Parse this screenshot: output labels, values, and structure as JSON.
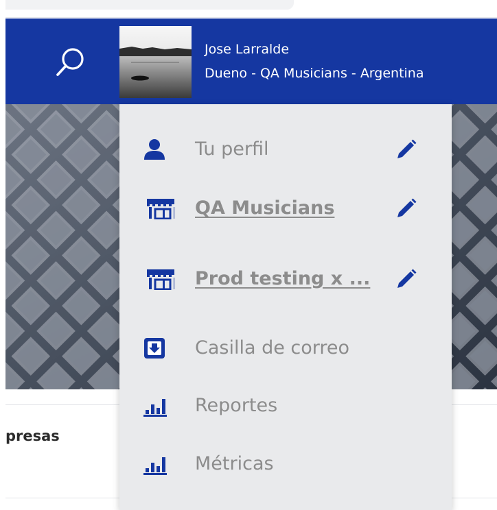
{
  "header": {
    "user_name": "Jose Larralde",
    "user_role": "Dueno - QA Musicians - Argentina"
  },
  "page": {
    "heading": "presas"
  },
  "menu": {
    "items": [
      {
        "label": "Tu perfil",
        "icon": "user-icon",
        "editable": true
      },
      {
        "label": "QA Musicians",
        "icon": "store-icon",
        "editable": true
      },
      {
        "label": "Prod testing x ...",
        "icon": "store-icon",
        "editable": true
      },
      {
        "label": "Casilla de correo",
        "icon": "inbox-icon",
        "editable": false
      },
      {
        "label": "Reportes",
        "icon": "bar-chart-icon",
        "editable": false
      },
      {
        "label": "Métricas",
        "icon": "bar-chart-icon",
        "editable": false
      }
    ]
  },
  "colors": {
    "brand": "#1537a1",
    "menu_background": "#e9eaec",
    "menu_text": "#8c8c8c",
    "icon": "#1537a1"
  }
}
